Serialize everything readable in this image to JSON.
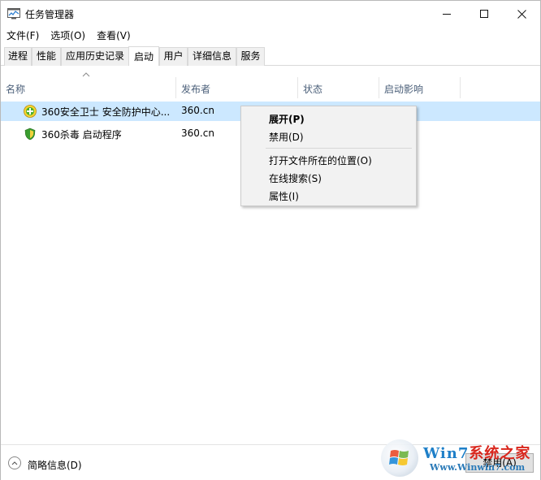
{
  "window": {
    "title": "任务管理器"
  },
  "menubar": {
    "items": [
      "文件(F)",
      "选项(O)",
      "查看(V)"
    ]
  },
  "tabs": [
    {
      "label": "进程",
      "active": false
    },
    {
      "label": "性能",
      "active": false
    },
    {
      "label": "应用历史记录",
      "active": false
    },
    {
      "label": "启动",
      "active": true
    },
    {
      "label": "用户",
      "active": false
    },
    {
      "label": "详细信息",
      "active": false
    },
    {
      "label": "服务",
      "active": false
    }
  ],
  "columns": [
    "名称",
    "发布者",
    "状态",
    "启动影响"
  ],
  "rows": [
    {
      "name": "360安全卫士 安全防护中心...",
      "publisher": "360.cn",
      "icon": "360-safe-guard-icon",
      "selected": true
    },
    {
      "name": "360杀毒 启动程序",
      "publisher": "360.cn",
      "icon": "360-antivirus-shield-icon",
      "selected": false
    }
  ],
  "context_menu": {
    "items": [
      {
        "label": "展开(P)",
        "default": true
      },
      {
        "label": "禁用(D)",
        "default": false
      },
      {
        "label": "打开文件所在的位置(O)",
        "default": false
      },
      {
        "label": "在线搜索(S)",
        "default": false
      },
      {
        "label": "属性(I)",
        "default": false
      }
    ]
  },
  "bottom": {
    "collapse_label": "简略信息(D)",
    "disable_button": "禁用(A)"
  },
  "watermark": {
    "title_a": "Win7",
    "title_b": "系统之家",
    "url": "Www.Winwin7.com"
  },
  "colors": {
    "selected_row": "#cce8ff",
    "header_text": "#4c607a",
    "watermark_blue": "#1e7fc8",
    "watermark_red": "#d9261c"
  }
}
